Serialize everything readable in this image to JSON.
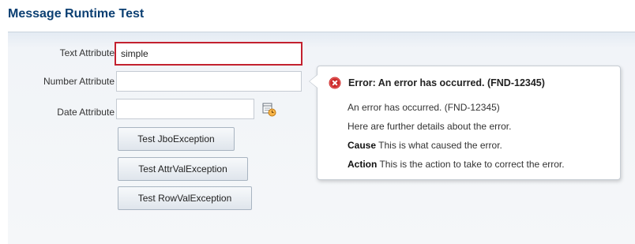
{
  "page": {
    "title": "Message Runtime Test"
  },
  "form": {
    "text_attribute": {
      "label": "Text Attribute",
      "value": "simple"
    },
    "number_attribute": {
      "label": "Number Attribute",
      "value": ""
    },
    "date_attribute": {
      "label": "Date Attribute",
      "value": "",
      "picker_icon": "calendar-icon"
    }
  },
  "buttons": {
    "jbo": "Test JboException",
    "attrval": "Test AttrValException",
    "rowval": "Test RowValException"
  },
  "error_popup": {
    "icon": "error-icon",
    "title": "Error: An error has occurred. (FND-12345)",
    "message": "An error has occurred. (FND-12345)",
    "details": "Here are further details about the error.",
    "cause_label": "Cause",
    "cause_text": "This is what caused the error.",
    "action_label": "Action",
    "action_text": "This is the action to take to correct the error."
  },
  "colors": {
    "title": "#0b3f72",
    "error_border": "#c3212f",
    "error_icon": "#cc2a2a"
  }
}
